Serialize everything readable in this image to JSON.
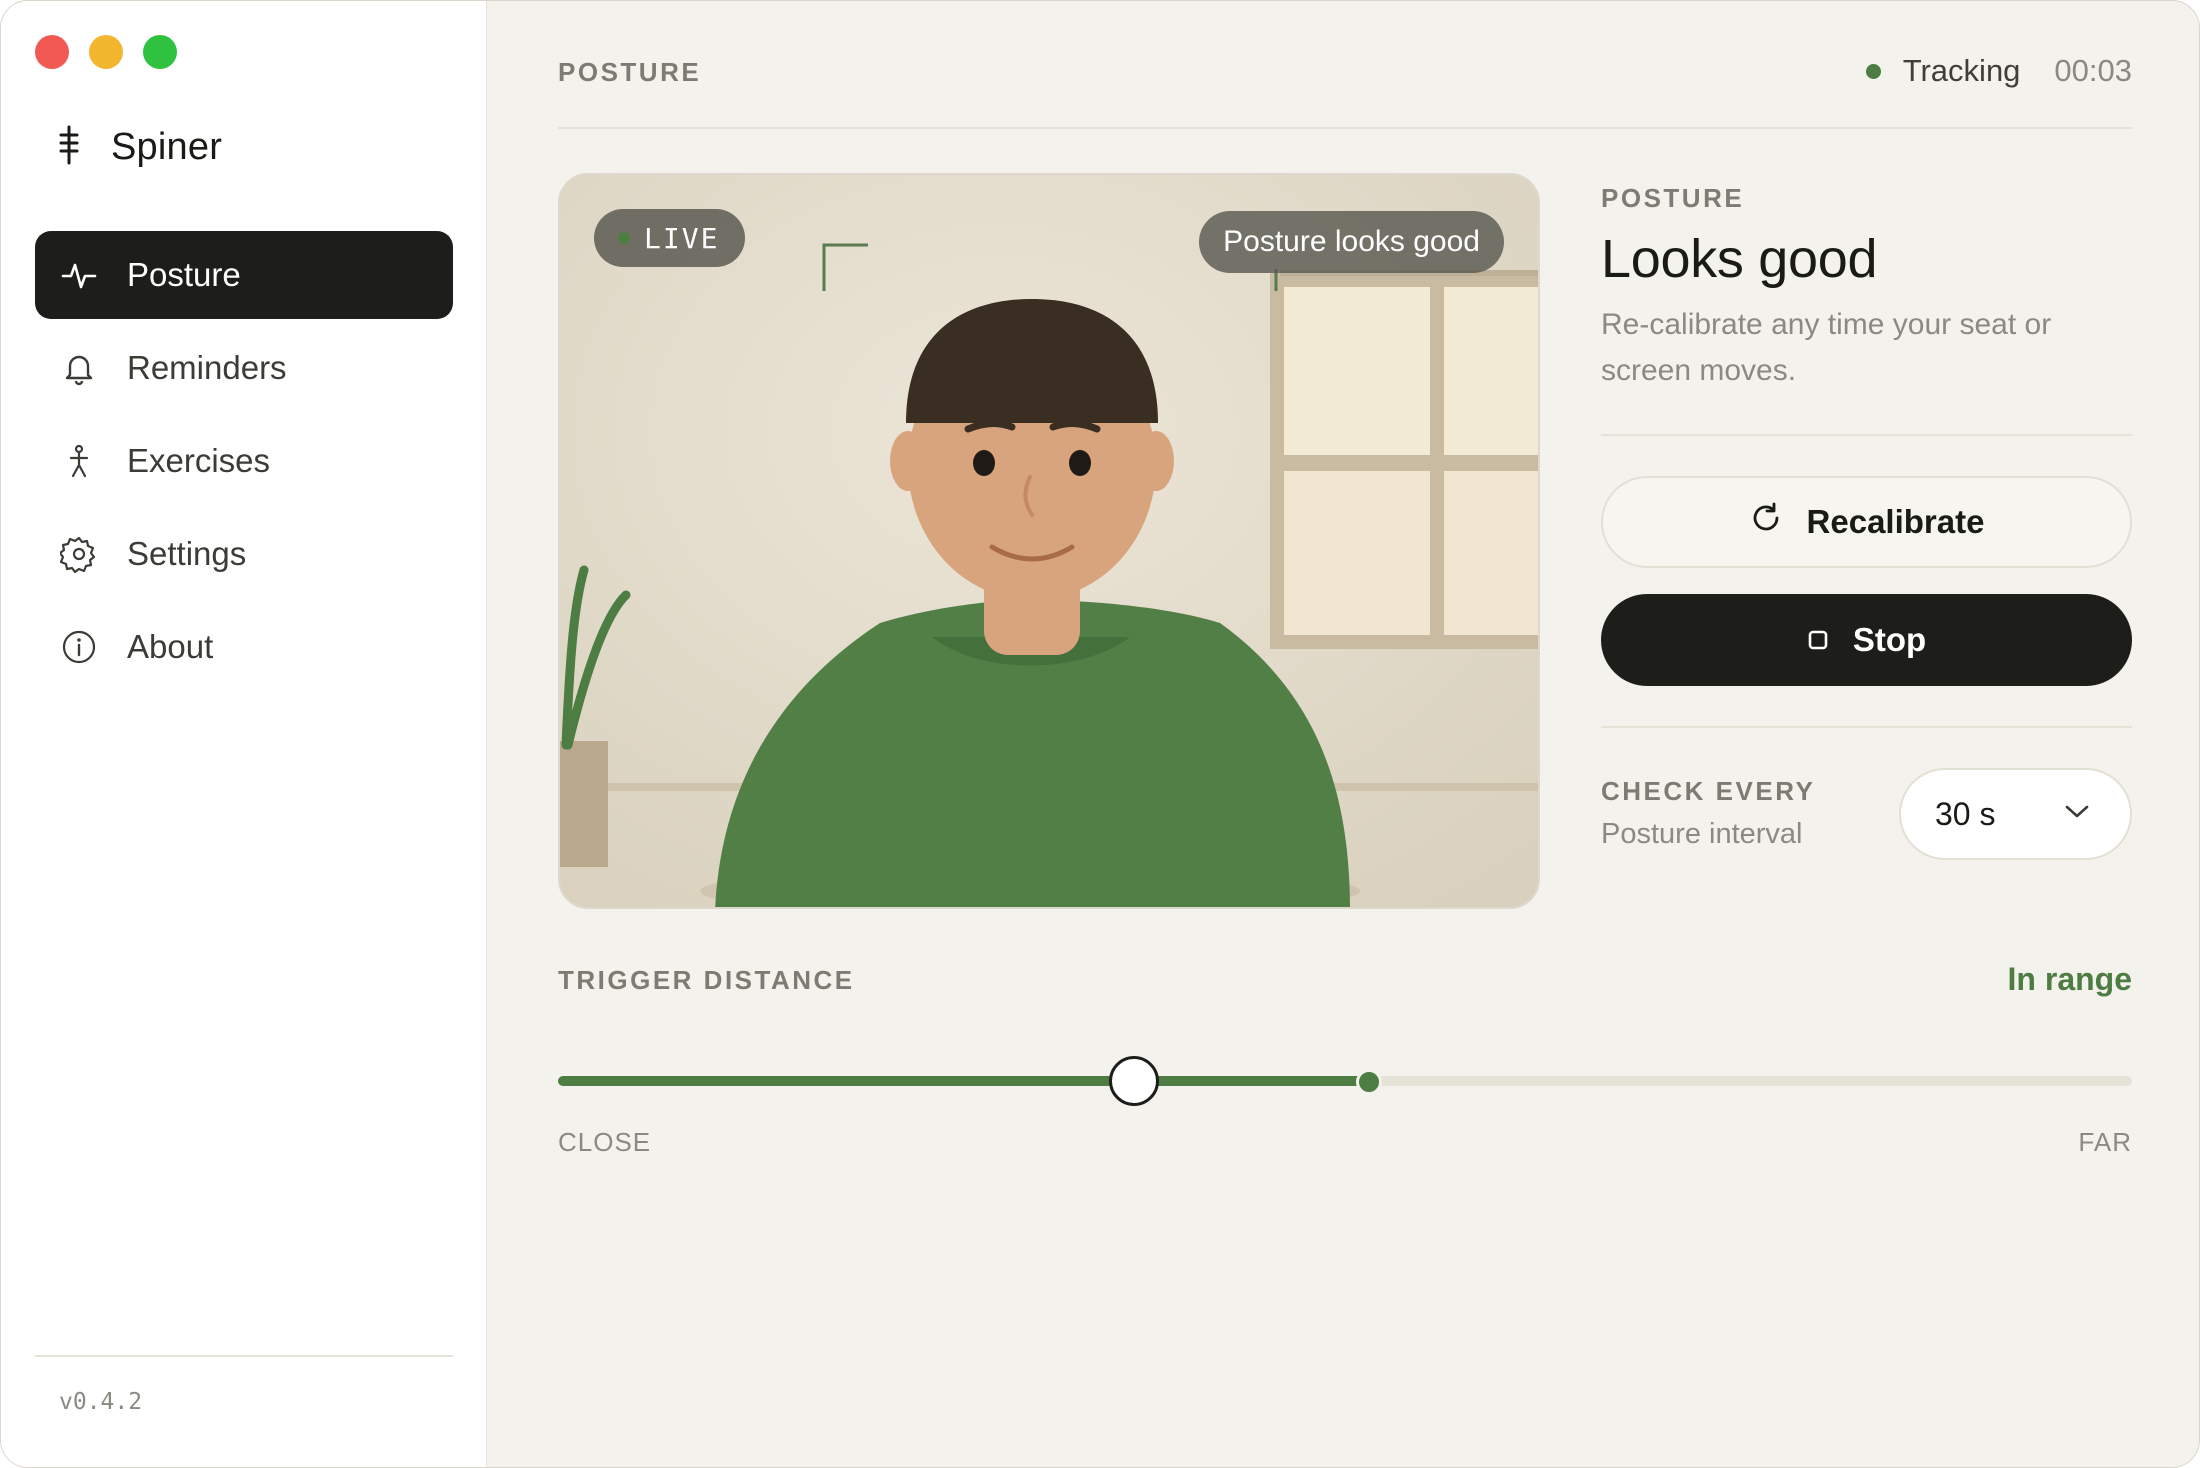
{
  "app": {
    "name": "Spiner",
    "version": "v0.4.2"
  },
  "sidebar": {
    "items": [
      {
        "label": "Posture",
        "icon": "activity-icon",
        "active": true
      },
      {
        "label": "Reminders",
        "icon": "bell-icon",
        "active": false
      },
      {
        "label": "Exercises",
        "icon": "person-icon",
        "active": false
      },
      {
        "label": "Settings",
        "icon": "gear-icon",
        "active": false
      },
      {
        "label": "About",
        "icon": "info-icon",
        "active": false
      }
    ]
  },
  "header": {
    "title": "POSTURE",
    "status": "Tracking",
    "elapsed": "00:03",
    "status_color": "#4e7d44"
  },
  "camera": {
    "live_label": "LIVE",
    "overlay_message": "Posture looks good"
  },
  "panel": {
    "eyebrow": "POSTURE",
    "title": "Looks good",
    "description": "Re-calibrate any time your seat or screen moves.",
    "recalibrate_label": "Recalibrate",
    "stop_label": "Stop",
    "interval_label": "CHECK EVERY",
    "interval_sub": "Posture interval",
    "interval_value": "30 s"
  },
  "trigger": {
    "label": "TRIGGER DISTANCE",
    "status": "In range",
    "min_label": "CLOSE",
    "max_label": "FAR",
    "threshold_fraction": 0.366,
    "current_fraction": 0.515
  },
  "colors": {
    "accent": "#4e7d44",
    "dark": "#1d1d1a",
    "background": "#f4f2ec"
  }
}
